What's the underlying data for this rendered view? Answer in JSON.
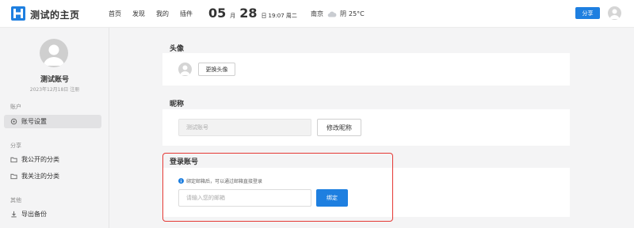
{
  "header": {
    "site_title": "测试的主页",
    "nav": [
      "首页",
      "发现",
      "我的",
      "插件"
    ],
    "date": {
      "month": "05",
      "month_unit": "月",
      "day": "28",
      "day_unit": "日",
      "time_weekday": "19:07 周二"
    },
    "weather": {
      "city": "南京",
      "condition": "阴",
      "temperature": "25°C"
    },
    "share_label": "分享",
    "brand_color": "#1e7fe0"
  },
  "sidebar": {
    "user_name": "测试账号",
    "join_text": "2023年12月18日 注册",
    "sections": [
      {
        "title": "账户",
        "items": [
          {
            "label": "账号设置",
            "icon": "gear-icon",
            "active": true
          }
        ]
      },
      {
        "title": "分享",
        "items": [
          {
            "label": "我公开的分类",
            "icon": "folder-icon"
          },
          {
            "label": "我关注的分类",
            "icon": "folder-icon"
          }
        ]
      },
      {
        "title": "其他",
        "items": [
          {
            "label": "导出备份",
            "icon": "download-icon"
          }
        ]
      }
    ]
  },
  "main": {
    "avatar_section": {
      "title": "头像",
      "change_button": "更换头像"
    },
    "nickname_section": {
      "title": "昵称",
      "input_value": "测试账号",
      "modify_button": "修改昵称"
    },
    "login_section": {
      "title": "登录账号",
      "hint": "绑定邮箱后，可以通过邮箱直接登录",
      "email_placeholder": "请输入您的邮箱",
      "bind_button": "绑定",
      "highlight_color": "#e53935"
    }
  }
}
